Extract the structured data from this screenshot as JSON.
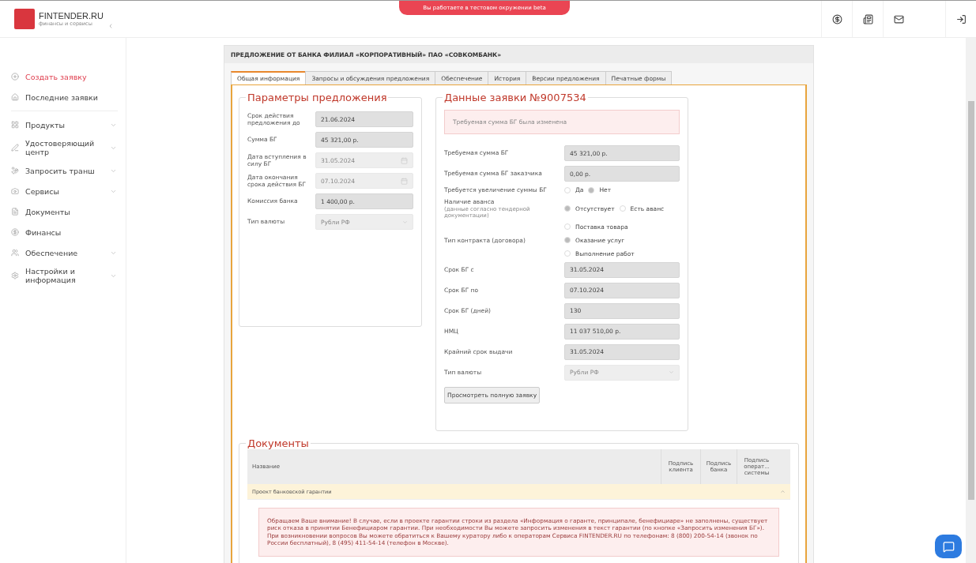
{
  "logo": {
    "name": "FINTENDER.RU",
    "tagline": "финансы и сервисы"
  },
  "banner": "Вы работаете в тестовом окружении beta",
  "sidebar": {
    "items": [
      {
        "label": "Создать заявку",
        "selected": true,
        "expandable": false
      },
      {
        "label": "Последние заявки",
        "selected": false,
        "expandable": false
      },
      {
        "label": "Продукты",
        "selected": false,
        "expandable": true
      },
      {
        "label": "Удостоверяющий центр",
        "selected": false,
        "expandable": true
      },
      {
        "label": "Запросить транш",
        "selected": false,
        "expandable": true
      },
      {
        "label": "Сервисы",
        "selected": false,
        "expandable": true
      },
      {
        "label": "Документы",
        "selected": false,
        "expandable": false
      },
      {
        "label": "Финансы",
        "selected": false,
        "expandable": false
      },
      {
        "label": "Обеспечение",
        "selected": false,
        "expandable": true
      },
      {
        "label": "Настройки и информация",
        "selected": false,
        "expandable": true
      }
    ]
  },
  "page_title": "ПРЕДЛОЖЕНИЕ ОТ БАНКА ФИЛИАЛ «КОРПОРАТИВНЫЙ» ПАО «СОВКОМБАНК»",
  "tabs": [
    {
      "label": "Общая информация",
      "selected": true
    },
    {
      "label": "Запросы и обсуждения предложения",
      "selected": false
    },
    {
      "label": "Обеспечение",
      "selected": false
    },
    {
      "label": "История",
      "selected": false
    },
    {
      "label": "Версии предложения",
      "selected": false
    },
    {
      "label": "Печатные формы",
      "selected": false
    }
  ],
  "offer_params": {
    "title": "Параметры предложения",
    "fields": [
      {
        "kind": "text",
        "label": "Срок действия предложения до",
        "value": "21.06.2024",
        "disabled": false
      },
      {
        "kind": "text",
        "label": "Сумма БГ",
        "value": "45 321,00 р.",
        "disabled": false
      },
      {
        "kind": "date",
        "label": "Дата вступления в силу БГ",
        "value": "31.05.2024",
        "disabled": true
      },
      {
        "kind": "date",
        "label": "Дата окончания срока действия БГ",
        "value": "07.10.2024",
        "disabled": true
      },
      {
        "kind": "text",
        "label": "Комиссия банка",
        "value": "1 400,00 р.",
        "disabled": false
      },
      {
        "kind": "select",
        "label": "Тип валюты",
        "value": "Рубли РФ",
        "disabled": true
      }
    ]
  },
  "application": {
    "title": "Данные заявки №9007534",
    "notice": "Требуемая сумма БГ была изменена",
    "fields": [
      {
        "kind": "text",
        "label": "Требуемая сумма БГ",
        "value": "45 321,00 р."
      },
      {
        "kind": "text",
        "label": "Требуемая сумма БГ заказчика",
        "value": "0,00 р."
      },
      {
        "kind": "radio_row",
        "label": "Требуется увеличение суммы БГ",
        "options": [
          {
            "label": "Да",
            "selected": false
          },
          {
            "label": "Нет",
            "selected": true
          }
        ]
      },
      {
        "kind": "radio_row",
        "label": "Наличие аванса",
        "hint": "(данные согласно тендерной документации)",
        "options": [
          {
            "label": "Отсутствует",
            "selected": true
          },
          {
            "label": "Есть аванс",
            "selected": false
          }
        ]
      },
      {
        "kind": "radio_column",
        "label": "Тип контракта (договора)",
        "options": [
          {
            "label": "Поставка товара",
            "selected": false
          },
          {
            "label": "Оказание услуг",
            "selected": true
          },
          {
            "label": "Выполнение работ",
            "selected": false
          }
        ]
      },
      {
        "kind": "text",
        "label": "Срок БГ с",
        "value": "31.05.2024"
      },
      {
        "kind": "text",
        "label": "Срок БГ по",
        "value": "07.10.2024"
      },
      {
        "kind": "text",
        "label": "Срок БГ (дней)",
        "value": "130"
      },
      {
        "kind": "text",
        "label": "НМЦ",
        "value": "11 037 510,00 р."
      },
      {
        "kind": "text",
        "label": "Крайний срок выдачи",
        "value": "31.05.2024"
      },
      {
        "kind": "select",
        "label": "Тип валюты",
        "value": "Рубли РФ"
      }
    ],
    "button": "Просмотреть полную заявку"
  },
  "documents": {
    "title": "Документы",
    "columns": [
      "Название",
      "Подпись клиента",
      "Подпись банка",
      "Подпись операт... системы"
    ],
    "group": "Проект банковской гарантии",
    "warning": "Обращаем Ваше внимание! В случае, если в проекте гарантии строки из раздела «Информация о гаранте, принципале, бенефициаре» не заполнены, существует риск отказа в принятии Бенефициаром гарантии. При необходимости Вы можете запросить изменения в текст гарантии (по кнопке «Запросить изменения БГ»). При возникновении вопросов Вы можете обратиться к Вашему куратору либо к операторам Сервиса FINTENDER.RU по телефонам: 8 (800) 200-54-14 (звонок по России бесплатный), 8 (495) 411-54-14 (телефон в Москве)."
  }
}
